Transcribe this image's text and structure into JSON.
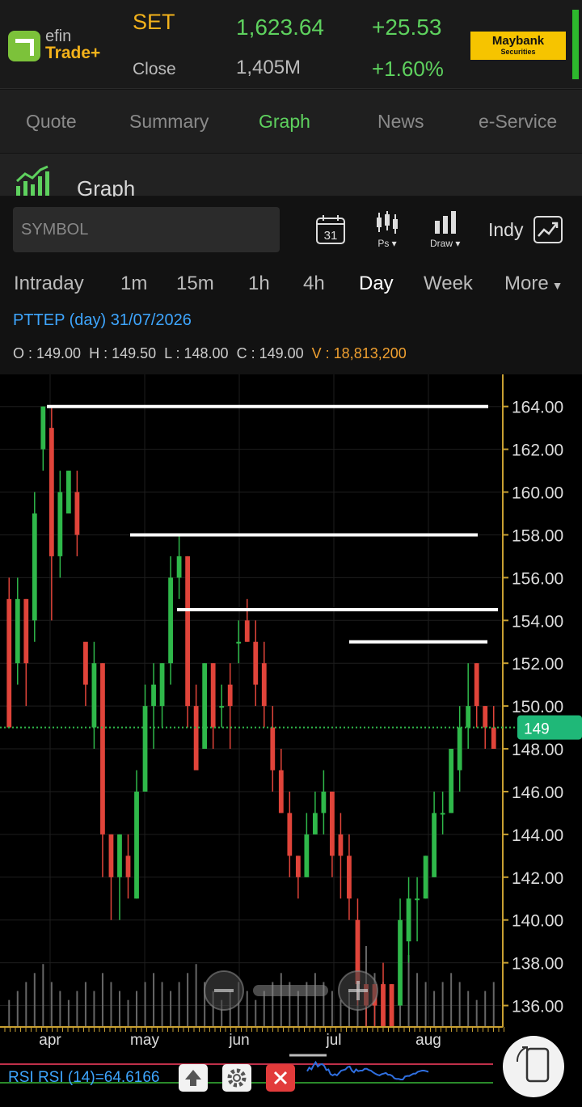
{
  "header": {
    "brand_top": "efin",
    "brand_bottom": "Trade+",
    "index_name": "SET",
    "index_value": "1,623.64",
    "index_change": "+25.53",
    "close_label": "Close",
    "volume": "1,405M",
    "change_pct": "+1.60%",
    "broker_name": "Maybank",
    "broker_sub": "Securities"
  },
  "tabs": [
    "Quote",
    "Summary",
    "Graph",
    "News",
    "e-Service"
  ],
  "active_tab": "Graph",
  "section": {
    "title": "Graph"
  },
  "toolbar": {
    "symbol_placeholder": "SYMBOL",
    "calendar_day": "31",
    "chart_type_label": "Ps",
    "draw_label": "Draw",
    "indicator_label": "Indy"
  },
  "periods": [
    "Intraday",
    "1m",
    "15m",
    "1h",
    "4h",
    "Day",
    "Week",
    "More"
  ],
  "active_period": "Day",
  "info": {
    "symbol_line": "PTTEP (day) 31/07/2026",
    "open": "O : 149.00",
    "high": "H : 149.50",
    "low": "L : 148.00",
    "close": "C : 149.00",
    "volume": "V : 18,813,200"
  },
  "chart_data": {
    "type": "candlestick",
    "y_ticks": [
      "164.00",
      "162.00",
      "160.00",
      "158.00",
      "156.00",
      "154.00",
      "152.00",
      "150.00",
      "148.00",
      "146.00",
      "144.00",
      "142.00",
      "140.00",
      "138.00",
      "136.00"
    ],
    "x_ticks": [
      "apr",
      "may",
      "jun",
      "jul",
      "aug"
    ],
    "last_price": "149",
    "last_price_value": 149,
    "ylim": [
      135.0,
      165.5
    ],
    "horizontal_lines": [
      164.0,
      158.0,
      154.5,
      153.0
    ],
    "candles": [
      [
        155,
        149,
        156,
        149
      ],
      [
        152,
        155,
        156,
        151
      ],
      [
        155,
        152,
        155,
        150
      ],
      [
        154,
        159,
        160,
        153
      ],
      [
        162,
        164,
        164,
        161
      ],
      [
        163,
        157,
        164,
        154
      ],
      [
        157,
        160,
        161,
        156
      ],
      [
        159,
        161,
        161,
        159
      ],
      [
        160,
        158,
        161,
        157
      ],
      [
        153,
        151,
        152,
        150
      ],
      [
        149,
        152,
        153,
        148
      ],
      [
        152,
        144,
        152,
        142
      ],
      [
        144,
        142,
        144,
        140
      ],
      [
        142,
        144,
        144,
        140
      ],
      [
        143,
        142,
        144,
        141
      ],
      [
        141,
        146,
        147,
        141
      ],
      [
        146,
        150,
        151,
        146
      ],
      [
        150,
        151,
        152,
        148
      ],
      [
        150,
        152,
        152,
        149
      ],
      [
        152,
        156,
        157,
        151
      ],
      [
        156,
        157,
        158,
        155
      ],
      [
        157,
        150,
        157,
        149
      ],
      [
        150,
        147,
        151,
        147
      ],
      [
        148,
        152,
        152,
        148
      ],
      [
        152,
        149,
        152,
        148
      ],
      [
        150,
        150,
        151,
        149
      ],
      [
        151,
        150,
        152,
        148
      ],
      [
        153,
        153,
        154,
        152
      ],
      [
        154,
        153,
        155,
        153
      ],
      [
        153,
        151,
        154,
        150
      ],
      [
        152,
        150,
        153,
        149
      ],
      [
        149,
        147,
        150,
        146
      ],
      [
        147,
        145,
        148,
        145
      ],
      [
        145,
        143,
        146,
        142
      ],
      [
        143,
        142,
        143,
        141
      ],
      [
        142,
        144,
        145,
        142
      ],
      [
        144,
        145,
        146,
        144
      ],
      [
        145,
        146,
        147,
        144
      ],
      [
        146,
        143,
        146,
        142
      ],
      [
        144,
        143,
        145,
        141
      ],
      [
        143,
        141,
        144,
        140
      ],
      [
        140,
        137,
        141,
        136
      ],
      [
        137,
        136,
        137,
        135
      ],
      [
        137,
        136,
        137,
        135
      ],
      [
        137,
        135,
        138,
        135
      ],
      [
        137,
        135,
        137,
        135
      ],
      [
        136,
        140,
        141,
        136
      ],
      [
        139,
        141,
        142,
        138
      ],
      [
        141,
        141,
        142,
        139
      ],
      [
        141,
        143,
        143,
        141
      ],
      [
        142,
        145,
        146,
        142
      ],
      [
        145,
        145,
        146,
        144
      ],
      [
        145,
        148,
        148,
        145
      ],
      [
        147,
        149,
        150,
        146
      ],
      [
        149,
        150,
        152,
        148
      ],
      [
        152,
        150,
        152,
        149
      ],
      [
        150,
        149,
        150,
        148
      ],
      [
        149,
        148,
        150,
        148
      ]
    ],
    "volume": [
      3,
      4,
      5,
      6,
      7,
      5,
      4,
      3,
      4,
      5,
      4,
      6,
      5,
      4,
      3,
      4,
      5,
      6,
      5,
      4,
      5,
      6,
      7,
      5,
      4,
      3,
      4,
      5,
      4,
      3,
      4,
      5,
      6,
      5,
      4,
      5,
      6,
      5,
      4,
      3,
      4,
      8,
      9,
      6,
      5,
      4,
      7,
      8,
      6,
      5,
      4,
      5,
      6,
      5,
      4,
      3,
      4,
      5
    ],
    "rsi": {
      "label": "RSI RSI (14)=64.6166",
      "value": 64.6166
    }
  }
}
